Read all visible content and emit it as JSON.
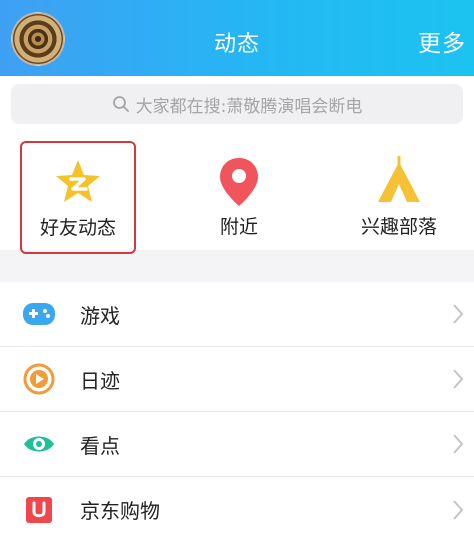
{
  "header": {
    "title": "动态",
    "more_label": "更多"
  },
  "search": {
    "placeholder": "大家都在搜:萧敬腾演唱会断电"
  },
  "quick": [
    {
      "label": "好友动态",
      "icon": "star-badge-icon",
      "color": "#f5c22a"
    },
    {
      "label": "附近",
      "icon": "location-pin-icon",
      "color": "#f0545c"
    },
    {
      "label": "兴趣部落",
      "icon": "tent-icon",
      "color": "#f6c235"
    }
  ],
  "list": [
    {
      "label": "游戏",
      "icon": "gamepad-icon",
      "color": "#3aa7f0"
    },
    {
      "label": "日迹",
      "icon": "play-circle-icon",
      "color": "#f29b37"
    },
    {
      "label": "看点",
      "icon": "eye-icon",
      "color": "#1fbf98"
    },
    {
      "label": "京东购物",
      "icon": "jd-bag-icon",
      "color": "#f0474c"
    }
  ],
  "colors": {
    "header_start": "#3fa0f3",
    "header_end": "#1cc3f0",
    "selected_border": "#cf3a3f"
  }
}
